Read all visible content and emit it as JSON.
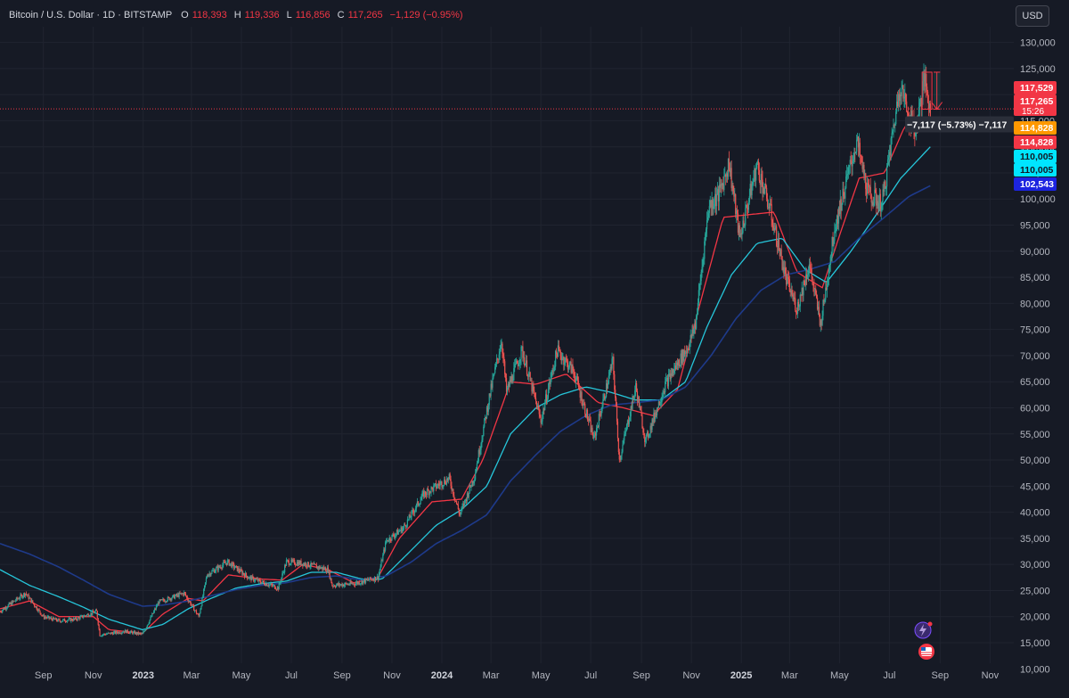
{
  "legend": {
    "symbol": "Bitcoin / U.S. Dollar · 1D · BITSTAMP",
    "o_key": "O",
    "o_val": "118,393",
    "h_key": "H",
    "h_val": "119,336",
    "l_key": "L",
    "l_val": "116,856",
    "c_key": "C",
    "c_val": "117,265",
    "change": "−1,129 (−0.95%)"
  },
  "currency": "USD",
  "measure_label": "−7,117 (−5.73%) −7,117",
  "colors": {
    "background": "#161a25",
    "up": "#26a69a",
    "down": "#ef5350",
    "ema_fast": "#f23645",
    "ema_mid": "#26c6da",
    "ema_slow": "#1e3a8a"
  },
  "chart_data": {
    "type": "candlestick",
    "title": "Bitcoin / U.S. Dollar · 1D · BITSTAMP",
    "ylim": [
      8000,
      133000
    ],
    "y_ticks": [
      10000,
      15000,
      20000,
      25000,
      30000,
      35000,
      40000,
      45000,
      50000,
      55000,
      60000,
      65000,
      70000,
      75000,
      80000,
      85000,
      90000,
      95000,
      100000,
      105000,
      110000,
      115000,
      120000,
      125000,
      130000
    ],
    "y_tick_labels": [
      "10,000",
      "15,000",
      "20,000",
      "25,000",
      "30,000",
      "35,000",
      "40,000",
      "45,000",
      "50,000",
      "55,000",
      "60,000",
      "65,000",
      "70,000",
      "75,000",
      "80,000",
      "85,000",
      "90,000",
      "95,000",
      "100,000",
      "105,000",
      "110,000",
      "115,000",
      "120,000",
      "125,000",
      "130,000"
    ],
    "xlim": [
      "2022-07-10",
      "2025-11-30"
    ],
    "x_ticks": [
      {
        "date": "2022-09-01",
        "label": "Sep",
        "bold": false
      },
      {
        "date": "2022-11-01",
        "label": "Nov",
        "bold": false
      },
      {
        "date": "2023-01-01",
        "label": "2023",
        "bold": true
      },
      {
        "date": "2023-03-01",
        "label": "Mar",
        "bold": false
      },
      {
        "date": "2023-05-01",
        "label": "May",
        "bold": false
      },
      {
        "date": "2023-07-01",
        "label": "Jul",
        "bold": false
      },
      {
        "date": "2023-09-01",
        "label": "Sep",
        "bold": false
      },
      {
        "date": "2023-11-01",
        "label": "Nov",
        "bold": false
      },
      {
        "date": "2024-01-01",
        "label": "2024",
        "bold": true
      },
      {
        "date": "2024-03-01",
        "label": "Mar",
        "bold": false
      },
      {
        "date": "2024-05-01",
        "label": "May",
        "bold": false
      },
      {
        "date": "2024-07-01",
        "label": "Jul",
        "bold": false
      },
      {
        "date": "2024-09-01",
        "label": "Sep",
        "bold": false
      },
      {
        "date": "2024-11-01",
        "label": "Nov",
        "bold": false
      },
      {
        "date": "2025-01-01",
        "label": "2025",
        "bold": true
      },
      {
        "date": "2025-03-01",
        "label": "Mar",
        "bold": false
      },
      {
        "date": "2025-05-01",
        "label": "May",
        "bold": false
      },
      {
        "date": "2025-07-01",
        "label": "Jul",
        "bold": false
      },
      {
        "date": "2025-09-01",
        "label": "Sep",
        "bold": false
      },
      {
        "date": "2025-11-01",
        "label": "Nov",
        "bold": false
      }
    ],
    "price_path": [
      [
        "2022-07-10",
        21000
      ],
      [
        "2022-08-10",
        24500
      ],
      [
        "2022-09-01",
        20000
      ],
      [
        "2022-09-20",
        19200
      ],
      [
        "2022-10-10",
        19500
      ],
      [
        "2022-11-05",
        21000
      ],
      [
        "2022-11-09",
        16500
      ],
      [
        "2022-12-10",
        17200
      ],
      [
        "2022-12-31",
        16600
      ],
      [
        "2023-01-20",
        22800
      ],
      [
        "2023-02-20",
        24500
      ],
      [
        "2023-03-10",
        20000
      ],
      [
        "2023-03-20",
        28000
      ],
      [
        "2023-04-14",
        30500
      ],
      [
        "2023-05-10",
        27500
      ],
      [
        "2023-06-15",
        25500
      ],
      [
        "2023-06-25",
        30500
      ],
      [
        "2023-07-15",
        30200
      ],
      [
        "2023-08-15",
        29000
      ],
      [
        "2023-08-20",
        26000
      ],
      [
        "2023-09-15",
        26300
      ],
      [
        "2023-10-15",
        27500
      ],
      [
        "2023-10-25",
        34500
      ],
      [
        "2023-11-15",
        37000
      ],
      [
        "2023-12-10",
        43500
      ],
      [
        "2024-01-10",
        46500
      ],
      [
        "2024-01-23",
        39500
      ],
      [
        "2024-02-10",
        47000
      ],
      [
        "2024-02-28",
        62000
      ],
      [
        "2024-03-14",
        73000
      ],
      [
        "2024-03-20",
        63000
      ],
      [
        "2024-04-08",
        71000
      ],
      [
        "2024-05-01",
        57500
      ],
      [
        "2024-05-21",
        71000
      ],
      [
        "2024-06-10",
        67000
      ],
      [
        "2024-07-05",
        54000
      ],
      [
        "2024-07-28",
        69000
      ],
      [
        "2024-08-05",
        50000
      ],
      [
        "2024-08-25",
        64000
      ],
      [
        "2024-09-06",
        53500
      ],
      [
        "2024-09-30",
        64500
      ],
      [
        "2024-10-29",
        72000
      ],
      [
        "2024-11-06",
        76000
      ],
      [
        "2024-11-22",
        98500
      ],
      [
        "2024-12-05",
        101000
      ],
      [
        "2024-12-17",
        107000
      ],
      [
        "2024-12-30",
        92500
      ],
      [
        "2025-01-20",
        106500
      ],
      [
        "2025-02-05",
        98000
      ],
      [
        "2025-02-25",
        84500
      ],
      [
        "2025-03-10",
        79000
      ],
      [
        "2025-03-25",
        87500
      ],
      [
        "2025-04-08",
        76000
      ],
      [
        "2025-04-25",
        94500
      ],
      [
        "2025-05-22",
        111000
      ],
      [
        "2025-06-05",
        101000
      ],
      [
        "2025-06-22",
        99000
      ],
      [
        "2025-07-14",
        122000
      ],
      [
        "2025-07-25",
        116000
      ],
      [
        "2025-08-02",
        113000
      ],
      [
        "2025-08-13",
        123000
      ],
      [
        "2025-08-20",
        117265
      ]
    ],
    "series": [
      {
        "name": "",
        "kind": "ema",
        "color": "#f23645",
        "points": [
          [
            "2022-07-10",
            21500
          ],
          [
            "2022-08-15",
            23000
          ],
          [
            "2022-09-20",
            20000
          ],
          [
            "2022-11-01",
            20000
          ],
          [
            "2022-11-20",
            17500
          ],
          [
            "2022-12-31",
            16800
          ],
          [
            "2023-01-25",
            20500
          ],
          [
            "2023-02-25",
            23500
          ],
          [
            "2023-03-15",
            23000
          ],
          [
            "2023-04-15",
            28000
          ],
          [
            "2023-05-25",
            27200
          ],
          [
            "2023-06-20",
            27000
          ],
          [
            "2023-07-15",
            30000
          ],
          [
            "2023-08-15",
            29000
          ],
          [
            "2023-09-15",
            26500
          ],
          [
            "2023-10-15",
            27500
          ],
          [
            "2023-11-10",
            35000
          ],
          [
            "2023-12-20",
            42000
          ],
          [
            "2024-01-25",
            42500
          ],
          [
            "2024-02-20",
            50000
          ],
          [
            "2024-03-25",
            65000
          ],
          [
            "2024-04-25",
            64500
          ],
          [
            "2024-06-01",
            66500
          ],
          [
            "2024-07-10",
            61000
          ],
          [
            "2024-08-10",
            60000
          ],
          [
            "2024-09-15",
            58500
          ],
          [
            "2024-10-15",
            63500
          ],
          [
            "2024-11-15",
            82000
          ],
          [
            "2024-12-10",
            96500
          ],
          [
            "2025-01-10",
            97000
          ],
          [
            "2025-02-10",
            97500
          ],
          [
            "2025-03-10",
            86000
          ],
          [
            "2025-04-10",
            83000
          ],
          [
            "2025-05-01",
            93000
          ],
          [
            "2025-05-25",
            104000
          ],
          [
            "2025-06-25",
            105000
          ],
          [
            "2025-07-20",
            114000
          ],
          [
            "2025-08-20",
            114828
          ]
        ]
      },
      {
        "name": "",
        "kind": "ema",
        "color": "#26c6da",
        "points": [
          [
            "2022-07-10",
            29000
          ],
          [
            "2022-08-15",
            26000
          ],
          [
            "2022-09-20",
            23800
          ],
          [
            "2022-10-20",
            21800
          ],
          [
            "2022-11-20",
            19500
          ],
          [
            "2022-12-31",
            17500
          ],
          [
            "2023-01-25",
            18500
          ],
          [
            "2023-02-25",
            21500
          ],
          [
            "2023-03-25",
            23500
          ],
          [
            "2023-04-25",
            25500
          ],
          [
            "2023-05-25",
            26300
          ],
          [
            "2023-06-25",
            26800
          ],
          [
            "2023-07-25",
            28500
          ],
          [
            "2023-08-25",
            28500
          ],
          [
            "2023-09-25",
            27200
          ],
          [
            "2023-10-20",
            27200
          ],
          [
            "2023-11-20",
            32000
          ],
          [
            "2023-12-25",
            37500
          ],
          [
            "2024-01-25",
            40500
          ],
          [
            "2024-02-25",
            45000
          ],
          [
            "2024-03-25",
            55000
          ],
          [
            "2024-04-25",
            60000
          ],
          [
            "2024-05-25",
            62500
          ],
          [
            "2024-06-25",
            64000
          ],
          [
            "2024-07-25",
            63000
          ],
          [
            "2024-08-25",
            61500
          ],
          [
            "2024-09-25",
            61500
          ],
          [
            "2024-10-25",
            65000
          ],
          [
            "2024-11-20",
            75500
          ],
          [
            "2024-12-20",
            85500
          ],
          [
            "2025-01-20",
            91500
          ],
          [
            "2025-02-20",
            92500
          ],
          [
            "2025-03-20",
            86500
          ],
          [
            "2025-04-15",
            84000
          ],
          [
            "2025-05-15",
            90000
          ],
          [
            "2025-06-15",
            97000
          ],
          [
            "2025-07-15",
            104000
          ],
          [
            "2025-08-20",
            110005
          ]
        ]
      },
      {
        "name": "",
        "kind": "ema",
        "color": "#1e3a8a",
        "points": [
          [
            "2022-07-10",
            34000
          ],
          [
            "2022-08-15",
            32000
          ],
          [
            "2022-09-20",
            29500
          ],
          [
            "2022-10-20",
            27000
          ],
          [
            "2022-11-20",
            24300
          ],
          [
            "2022-12-31",
            22000
          ],
          [
            "2023-01-25",
            22200
          ],
          [
            "2023-02-25",
            23000
          ],
          [
            "2023-03-25",
            24000
          ],
          [
            "2023-04-25",
            25200
          ],
          [
            "2023-05-25",
            26000
          ],
          [
            "2023-06-25",
            26500
          ],
          [
            "2023-07-25",
            27500
          ],
          [
            "2023-08-25",
            27800
          ],
          [
            "2023-09-25",
            27000
          ],
          [
            "2023-10-25",
            27800
          ],
          [
            "2023-11-25",
            30500
          ],
          [
            "2023-12-25",
            34000
          ],
          [
            "2024-01-25",
            36500
          ],
          [
            "2024-02-25",
            39500
          ],
          [
            "2024-03-25",
            46000
          ],
          [
            "2024-04-25",
            51000
          ],
          [
            "2024-05-25",
            55500
          ],
          [
            "2024-06-25",
            58500
          ],
          [
            "2024-07-25",
            60500
          ],
          [
            "2024-08-25",
            61000
          ],
          [
            "2024-09-25",
            61500
          ],
          [
            "2024-10-25",
            64000
          ],
          [
            "2024-11-25",
            70000
          ],
          [
            "2024-12-25",
            77000
          ],
          [
            "2025-01-25",
            82500
          ],
          [
            "2025-02-25",
            85500
          ],
          [
            "2025-03-25",
            86500
          ],
          [
            "2025-04-25",
            88000
          ],
          [
            "2025-05-25",
            92500
          ],
          [
            "2025-06-25",
            96500
          ],
          [
            "2025-07-25",
            100500
          ],
          [
            "2025-08-20",
            102543
          ]
        ]
      }
    ],
    "measure_box": {
      "date_start": "2025-08-10",
      "date_end": "2025-08-22",
      "high": 124300,
      "low": 117200
    },
    "target_box": {
      "date_start": "2025-08-24",
      "date_end": "2025-09-01",
      "high": 124300,
      "low": 117200
    },
    "current_price_line": 117265,
    "price_tags": [
      {
        "text": "117,529",
        "value": 117529,
        "bg": "#f23645",
        "fg": "#ffffff"
      },
      {
        "text": "117,265",
        "value": 117265,
        "bg": "#f23645",
        "fg": "#ffffff",
        "sub": "15:26"
      },
      {
        "text": "114,828",
        "value": 114828,
        "bg": "#ff9800",
        "fg": "#ffffff"
      },
      {
        "text": "114,828",
        "value": 114828,
        "bg": "#f23645",
        "fg": "#ffffff"
      },
      {
        "text": "110,005",
        "value": 110005,
        "bg": "#00e5ff",
        "fg": "#131722"
      },
      {
        "text": "110,005",
        "value": 110005,
        "bg": "#00e5ff",
        "fg": "#131722"
      },
      {
        "text": "102,543",
        "value": 102543,
        "bg": "#1c24e0",
        "fg": "#ffffff"
      }
    ]
  }
}
